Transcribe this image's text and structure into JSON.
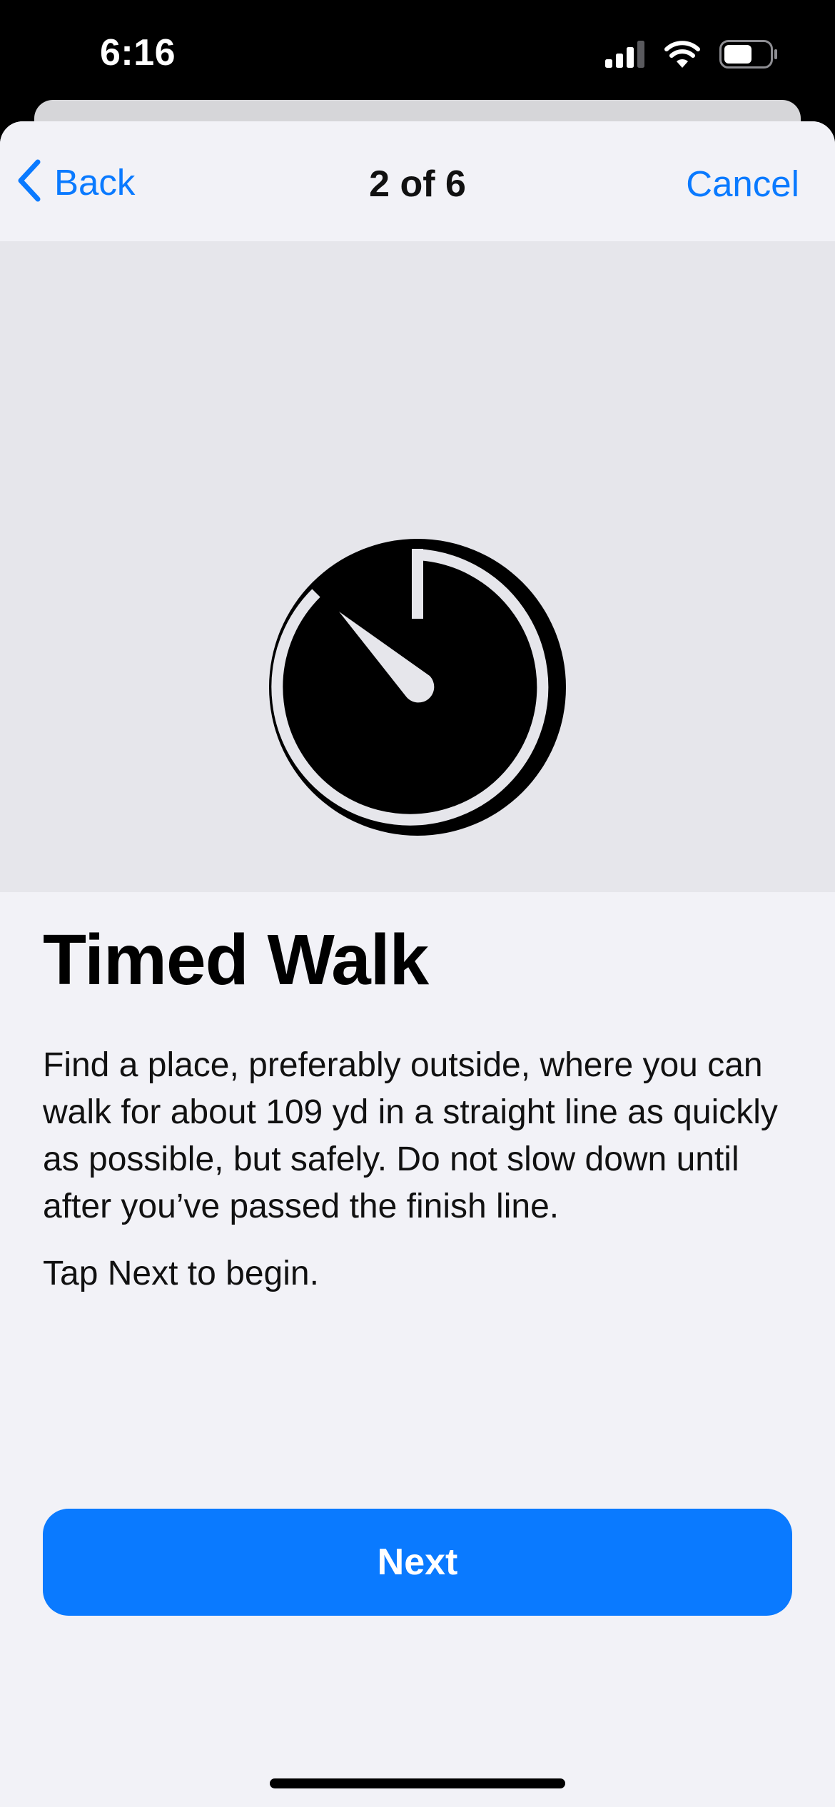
{
  "status_bar": {
    "time": "6:16",
    "icons": [
      "cellular-signal-icon",
      "wifi-icon",
      "battery-icon"
    ]
  },
  "nav": {
    "back_label": "Back",
    "title": "2 of 6",
    "cancel_label": "Cancel"
  },
  "hero": {
    "icon": "stopwatch-icon"
  },
  "content": {
    "title": "Timed Walk",
    "body": "Find a place, preferably outside, where you can walk for about 109 yd in a straight line as quickly as possible, but safely. Do not slow down until after you’ve passed the finish line.",
    "hint": "Tap Next to begin."
  },
  "actions": {
    "next_label": "Next"
  },
  "colors": {
    "accent": "#0a7aff",
    "background": "#f2f2f7",
    "hero_background": "#e6e6eb"
  }
}
